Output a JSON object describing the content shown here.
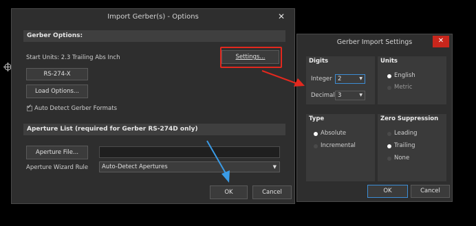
{
  "main_dialog": {
    "title": "Import Gerber(s) - Options",
    "close": "✕",
    "gerber_options_header": "Gerber Options:",
    "start_units": "Start Units: 2.3 Trailing Abs Inch",
    "settings_button": "Settings...",
    "rs274x_button": "RS-274-X",
    "load_options_button": "Load Options...",
    "auto_detect_label": "Auto Detect Gerber Formats",
    "aperture_header": "Aperture List (required for Gerber RS-274D only)",
    "aperture_file_button": "Aperture File...",
    "aperture_file_value": "",
    "wizard_rule_label": "Aperture Wizard Rule",
    "wizard_rule_value": "Auto-Detect Apertures",
    "ok_button": "OK",
    "cancel_button": "Cancel"
  },
  "settings_dialog": {
    "title": "Gerber Import Settings",
    "close": "✕",
    "digits": {
      "header": "Digits",
      "integer_label": "Integer",
      "integer_value": "2",
      "decimal_label": "Decimal",
      "decimal_value": "3"
    },
    "units": {
      "header": "Units",
      "options": [
        "English",
        "Metric"
      ],
      "selected": "English"
    },
    "type": {
      "header": "Type",
      "options": [
        "Absolute",
        "Incremental"
      ],
      "selected": "Absolute"
    },
    "zero_suppression": {
      "header": "Zero Suppression",
      "options": [
        "Leading",
        "Trailing",
        "None"
      ],
      "selected": "Trailing"
    },
    "ok_button": "OK",
    "cancel_button": "Cancel"
  },
  "colors": {
    "highlight": "#e3281e",
    "arrow_red": "#e3281e",
    "arrow_blue": "#3a9be6",
    "close_red": "#c8261c"
  }
}
